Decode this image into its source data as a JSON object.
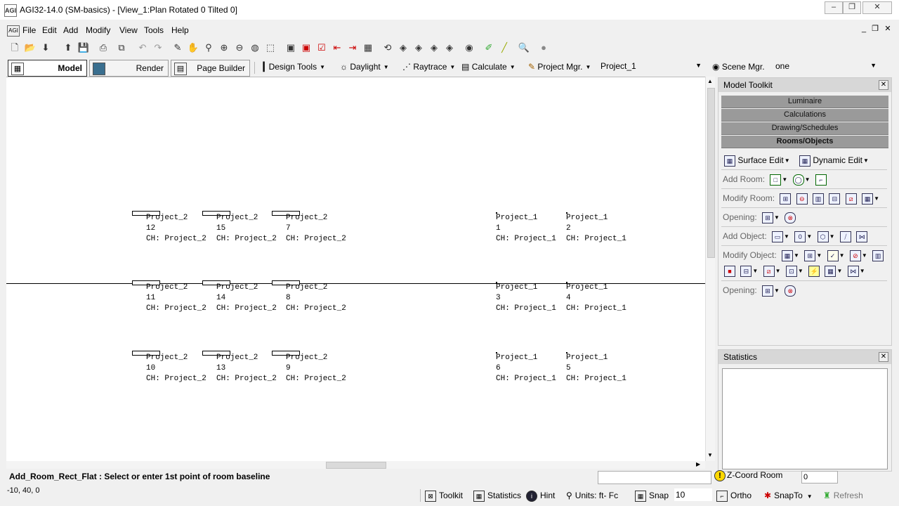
{
  "window": {
    "title": "AGI32-14.0 (SM-basics) - [View_1:Plan Rotated 0 Tilted 0]",
    "logo": "AGI",
    "controls": {
      "minimize": "–",
      "restore": "❐",
      "close": "✕"
    },
    "mdi_controls": {
      "minimize": "_",
      "restore": "❐",
      "close": "✕"
    }
  },
  "menu": [
    "File",
    "Edit",
    "Add",
    "Modify",
    "View",
    "Tools",
    "Help"
  ],
  "toolbar_icons": [
    "new-icon",
    "open-icon",
    "download-icon",
    "upload-icon",
    "save-icon",
    "print-icon",
    "copy-icon",
    "undo-icon",
    "redo-icon",
    "pencil-icon",
    "pan-icon",
    "zoom-icon",
    "zoom-in-icon",
    "zoom-out-icon",
    "zoom-window-icon",
    "zoom-extents-icon",
    "view-icon",
    "view-red-icon",
    "view-check-icon",
    "arrow-left-icon",
    "arrow-right-icon",
    "render-icon",
    "rotate-icon",
    "rotate2-icon",
    "rotate3-icon",
    "rotate4-icon",
    "camera-icon",
    "edit-icon",
    "measure-icon",
    "find-icon",
    "sphere-icon"
  ],
  "modes": {
    "model": "Model",
    "render": "Render",
    "page_builder": "Page Builder"
  },
  "toolbar2": {
    "design_tools": "Design Tools",
    "daylight": "Daylight",
    "raytrace": "Raytrace",
    "calculate": "Calculate",
    "project_mgr": "Project Mgr.",
    "project_value": "Project_1",
    "scene_mgr": "Scene Mgr.",
    "scene_value": "one"
  },
  "drawing": {
    "luminaires": [
      {
        "name": "Project_2",
        "num": "12",
        "ch": "CH: Project_2"
      },
      {
        "name": "Project_2",
        "num": "15",
        "ch": "CH: Project_2"
      },
      {
        "name": "Project_2",
        "num": "7",
        "ch": "CH: Project_2"
      },
      {
        "name": "Project_1",
        "num": "1",
        "ch": "CH: Project_1"
      },
      {
        "name": "Project_1",
        "num": "2",
        "ch": "CH: Project_1"
      },
      {
        "name": "Project_2",
        "num": "11",
        "ch": "CH: Project_2"
      },
      {
        "name": "Project_2",
        "num": "14",
        "ch": "CH: Project_2"
      },
      {
        "name": "Project_2",
        "num": "8",
        "ch": "CH: Project_2"
      },
      {
        "name": "Project_1",
        "num": "3",
        "ch": "CH: Project_1"
      },
      {
        "name": "Project_1",
        "num": "4",
        "ch": "CH: Project_1"
      },
      {
        "name": "Project_2",
        "num": "10",
        "ch": "CH: Project_2"
      },
      {
        "name": "Project_2",
        "num": "13",
        "ch": "CH: Project_2"
      },
      {
        "name": "Project_2",
        "num": "9",
        "ch": "CH: Project_2"
      },
      {
        "name": "Project_1",
        "num": "6",
        "ch": "CH: Project_1"
      },
      {
        "name": "Project_1",
        "num": "5",
        "ch": "CH: Project_1"
      }
    ]
  },
  "toolkit": {
    "title": "Model Toolkit",
    "categories": [
      "Luminaire",
      "Calculations",
      "Drawing/Schedules",
      "Rooms/Objects"
    ],
    "surface_edit": "Surface Edit",
    "dynamic_edit": "Dynamic Edit",
    "add_room": "Add Room:",
    "modify_room": "Modify Room:",
    "opening": "Opening:",
    "add_object": "Add Object:",
    "modify_object": "Modify Object:",
    "opening2": "Opening:"
  },
  "statistics": {
    "title": "Statistics"
  },
  "command": {
    "prompt": "Add_Room_Rect_Flat : Select or enter 1st point of room baseline",
    "coords": "-10, 40, 0",
    "zcoord_label": "Z-Coord Room",
    "zcoord_value": "0"
  },
  "statusbar": {
    "toolkit": "Toolkit",
    "statistics": "Statistics",
    "hint": "Hint",
    "units": "Units: ft- Fc",
    "snap": "Snap",
    "snap_value": "10",
    "ortho": "Ortho",
    "snapto": "SnapTo",
    "refresh": "Refresh"
  }
}
